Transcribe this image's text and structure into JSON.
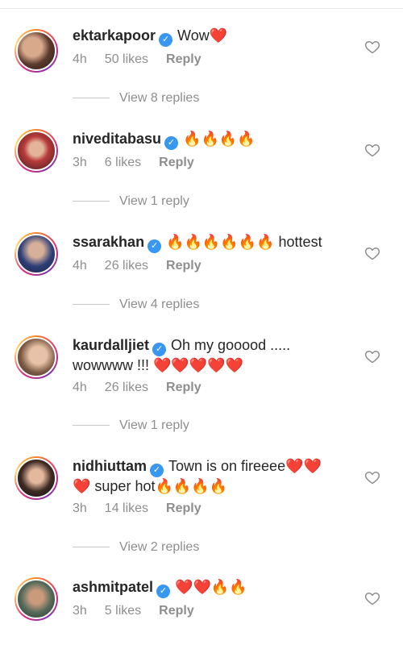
{
  "comments": [
    {
      "username": "ektarkapoor",
      "text": "Wow❤️",
      "time": "4h",
      "likes": "50 likes",
      "reply": "Reply",
      "view_replies": "View 8 replies"
    },
    {
      "username": "niveditabasu",
      "text": "🔥🔥🔥🔥",
      "time": "3h",
      "likes": "6 likes",
      "reply": "Reply",
      "view_replies": "View 1 reply"
    },
    {
      "username": "ssarakhan",
      "text": "🔥🔥🔥🔥🔥🔥 hottest",
      "time": "4h",
      "likes": "26 likes",
      "reply": "Reply",
      "view_replies": "View 4 replies"
    },
    {
      "username": "kaurdalljiet",
      "text": "Oh my gooood ..... wowwww !!! ❤️❤️❤️❤️❤️",
      "time": "4h",
      "likes": "26 likes",
      "reply": "Reply",
      "view_replies": "View 1 reply"
    },
    {
      "username": "nidhiuttam",
      "text": "Town is on fireeee❤️❤️❤️ super hot🔥🔥🔥🔥",
      "time": "3h",
      "likes": "14 likes",
      "reply": "Reply",
      "view_replies": "View 2 replies"
    },
    {
      "username": "ashmitpatel",
      "text": "❤️❤️🔥🔥",
      "time": "3h",
      "likes": "5 likes",
      "reply": "Reply"
    }
  ],
  "icons": {
    "verified": "verified-badge-icon",
    "like": "heart-outline-icon"
  },
  "colors": {
    "verified": "#3897f0",
    "muted": "#8e8e8e",
    "text": "#262626"
  }
}
